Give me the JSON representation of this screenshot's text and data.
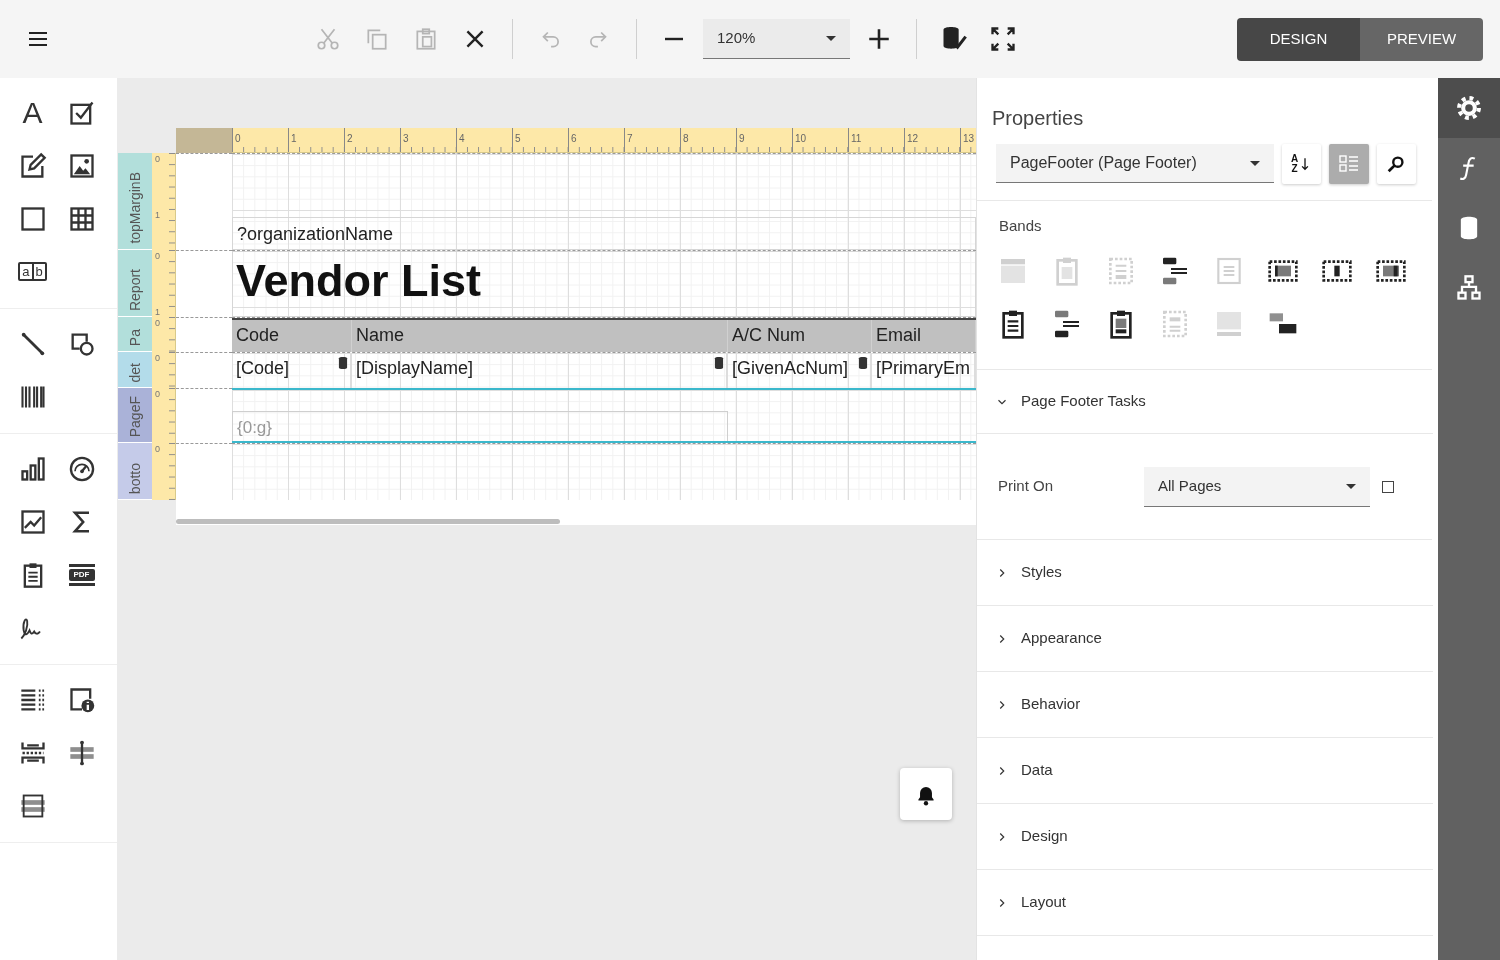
{
  "toolbar": {
    "groups": [
      [
        {
          "kind": "cut",
          "disabled": true
        },
        {
          "kind": "copy",
          "disabled": true
        },
        {
          "kind": "paste",
          "disabled": true
        },
        {
          "kind": "delete",
          "disabled": false
        }
      ],
      [
        {
          "kind": "undo",
          "disabled": true
        },
        {
          "kind": "redo",
          "disabled": true
        }
      ],
      [
        {
          "kind": "zoom-out",
          "disabled": false
        },
        {
          "kind": "zoom",
          "value": "120%"
        },
        {
          "kind": "zoom-in",
          "disabled": false
        }
      ],
      [
        {
          "kind": "validate",
          "disabled": false
        },
        {
          "kind": "fullscreen",
          "disabled": false
        }
      ]
    ],
    "mode_tabs": [
      {
        "label": "DESIGN",
        "selected": true
      },
      {
        "label": "PREVIEW",
        "selected": false
      }
    ]
  },
  "toolbox": {
    "groups": [
      [
        {
          "kind": "label",
          "glyph": "A"
        },
        {
          "kind": "checkbox"
        },
        {
          "kind": "edit"
        },
        {
          "kind": "picture"
        },
        {
          "kind": "panel"
        },
        {
          "kind": "table"
        },
        {
          "kind": "comb",
          "glyphs": [
            "a",
            "b"
          ]
        }
      ],
      [
        {
          "kind": "line"
        },
        {
          "kind": "shape"
        },
        {
          "kind": "barcode"
        }
      ],
      [
        {
          "kind": "chart"
        },
        {
          "kind": "gauge"
        },
        {
          "kind": "sparkline"
        },
        {
          "kind": "sigma"
        },
        {
          "kind": "clipboard"
        },
        {
          "kind": "pdf",
          "glyph": "PDF"
        },
        {
          "kind": "signature"
        }
      ],
      [
        {
          "kind": "toc"
        },
        {
          "kind": "pageinfo"
        },
        {
          "kind": "pagebreak"
        },
        {
          "kind": "crossline"
        },
        {
          "kind": "crossbox"
        }
      ]
    ]
  },
  "ruler": {
    "labels": [
      "0",
      "1",
      "2",
      "3",
      "4",
      "5",
      "6",
      "7",
      "8",
      "9",
      "10",
      "11",
      "12",
      "13"
    ]
  },
  "bands": [
    {
      "label": "topMarginB",
      "color": "#b2dfdb",
      "selected": false,
      "ruler_labels": [
        "0",
        "1"
      ],
      "controls": [
        {
          "kind": "text",
          "text": "?organizationName"
        }
      ]
    },
    {
      "label": "Report",
      "color": "#b2dfdb",
      "selected": false,
      "ruler_labels": [
        "0",
        "1"
      ],
      "controls": [
        {
          "kind": "title",
          "text": "Vendor List"
        }
      ]
    },
    {
      "label": "Pa",
      "color": "#b2dfdb",
      "selected": false,
      "ruler_labels": [
        "0"
      ],
      "controls": [
        {
          "kind": "header_cells",
          "cells": [
            "Code",
            "Name",
            "A/C Num",
            "Email"
          ]
        }
      ]
    },
    {
      "label": "det",
      "color": "#b3dcea",
      "selected": false,
      "ruler_labels": [
        "0"
      ],
      "controls": [
        {
          "kind": "field_cells",
          "cells": [
            {
              "text": "[Code]",
              "bound": true
            },
            {
              "text": "[DisplayName]",
              "bound": true
            },
            {
              "text": "[GivenAcNum]",
              "bound": true
            },
            {
              "text": "[PrimaryEm",
              "bound": false
            }
          ]
        }
      ]
    },
    {
      "label": "PageF",
      "color": "#aab2d8",
      "selected": true,
      "ruler_labels": [
        "0"
      ],
      "controls": [
        {
          "kind": "expression",
          "text": "{0:g}"
        }
      ]
    },
    {
      "label": "botto",
      "color": "#c5cbe9",
      "selected": false,
      "ruler_labels": [
        "0"
      ]
    }
  ],
  "properties": {
    "title": "Properties",
    "component": "PageFooter (Page Footer)",
    "view_buttons": [
      {
        "kind": "sort",
        "glyphs": [
          "A",
          "Z"
        ],
        "selected": false
      },
      {
        "kind": "categories",
        "selected": true
      },
      {
        "kind": "search",
        "selected": false
      }
    ],
    "bands_title": "Bands",
    "band_buttons": [
      {
        "kind": "bar-top",
        "disabled": true
      },
      {
        "kind": "clipboard",
        "disabled": true
      },
      {
        "kind": "dashed",
        "disabled": true
      },
      {
        "kind": "stack-top",
        "disabled": false
      },
      {
        "kind": "page",
        "disabled": true
      },
      {
        "kind": "film-wide",
        "disabled": false
      },
      {
        "kind": "film-narrow",
        "disabled": false
      },
      {
        "kind": "film-mid",
        "disabled": false
      },
      {
        "kind": "clipboard-lines",
        "disabled": false
      },
      {
        "kind": "stack-bottom",
        "disabled": false
      },
      {
        "kind": "clipboard-bottom",
        "disabled": false
      },
      {
        "kind": "dashed-bottom",
        "disabled": true
      },
      {
        "kind": "bar-bottom",
        "disabled": true
      },
      {
        "kind": "cascade",
        "disabled": false
      }
    ],
    "sections": [
      {
        "title": "Page Footer Tasks",
        "expanded": true,
        "fields": [
          {
            "label": "Print On",
            "value": "All Pages",
            "checked": false
          }
        ]
      },
      {
        "title": "Styles",
        "expanded": false
      },
      {
        "title": "Appearance",
        "expanded": false
      },
      {
        "title": "Behavior",
        "expanded": false
      },
      {
        "title": "Data",
        "expanded": false
      },
      {
        "title": "Design",
        "expanded": false
      },
      {
        "title": "Layout",
        "expanded": false
      }
    ]
  },
  "rail": [
    {
      "kind": "settings",
      "selected": true
    },
    {
      "kind": "function",
      "selected": false
    },
    {
      "kind": "database",
      "selected": false
    },
    {
      "kind": "tree",
      "selected": false
    }
  ]
}
